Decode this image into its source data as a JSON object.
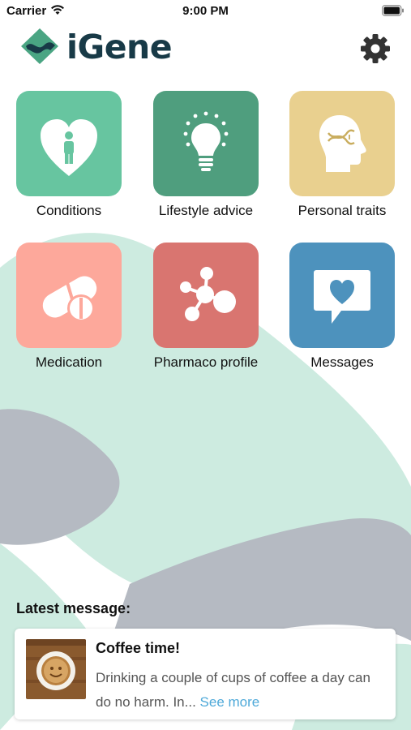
{
  "status_bar": {
    "carrier": "Carrier",
    "time": "9:00 PM",
    "wifi_icon": "wifi-icon",
    "battery_icon": "battery-icon"
  },
  "header": {
    "app_name": "iGene",
    "logo_icon": "igene-logo-icon",
    "settings_icon": "gear-icon"
  },
  "tiles": [
    {
      "label": "Conditions",
      "icon": "heart-person-icon",
      "color": "#67c5a0"
    },
    {
      "label": "Lifestyle advice",
      "icon": "lightbulb-icon",
      "color": "#4f9e7e"
    },
    {
      "label": "Personal traits",
      "icon": "head-dna-icon",
      "color": "#e9d08f"
    },
    {
      "label": "Medication",
      "icon": "pills-icon",
      "color": "#fda89b"
    },
    {
      "label": "Pharmaco profile",
      "icon": "molecule-icon",
      "color": "#d97570"
    },
    {
      "label": "Messages",
      "icon": "message-heart-icon",
      "color": "#4d92bd"
    }
  ],
  "latest": {
    "heading": "Latest message:",
    "title": "Coffee time!",
    "body": "Drinking a couple of cups of coffee a day can do no harm. In...",
    "see_more": "See more",
    "thumbnail_icon": "coffee-cup-icon"
  },
  "colors": {
    "brand_dark": "#183a47",
    "brand_green": "#4aa583",
    "mint_background": "#cdebe0",
    "gray_background": "#b5bac2",
    "link": "#4ea9d9"
  }
}
